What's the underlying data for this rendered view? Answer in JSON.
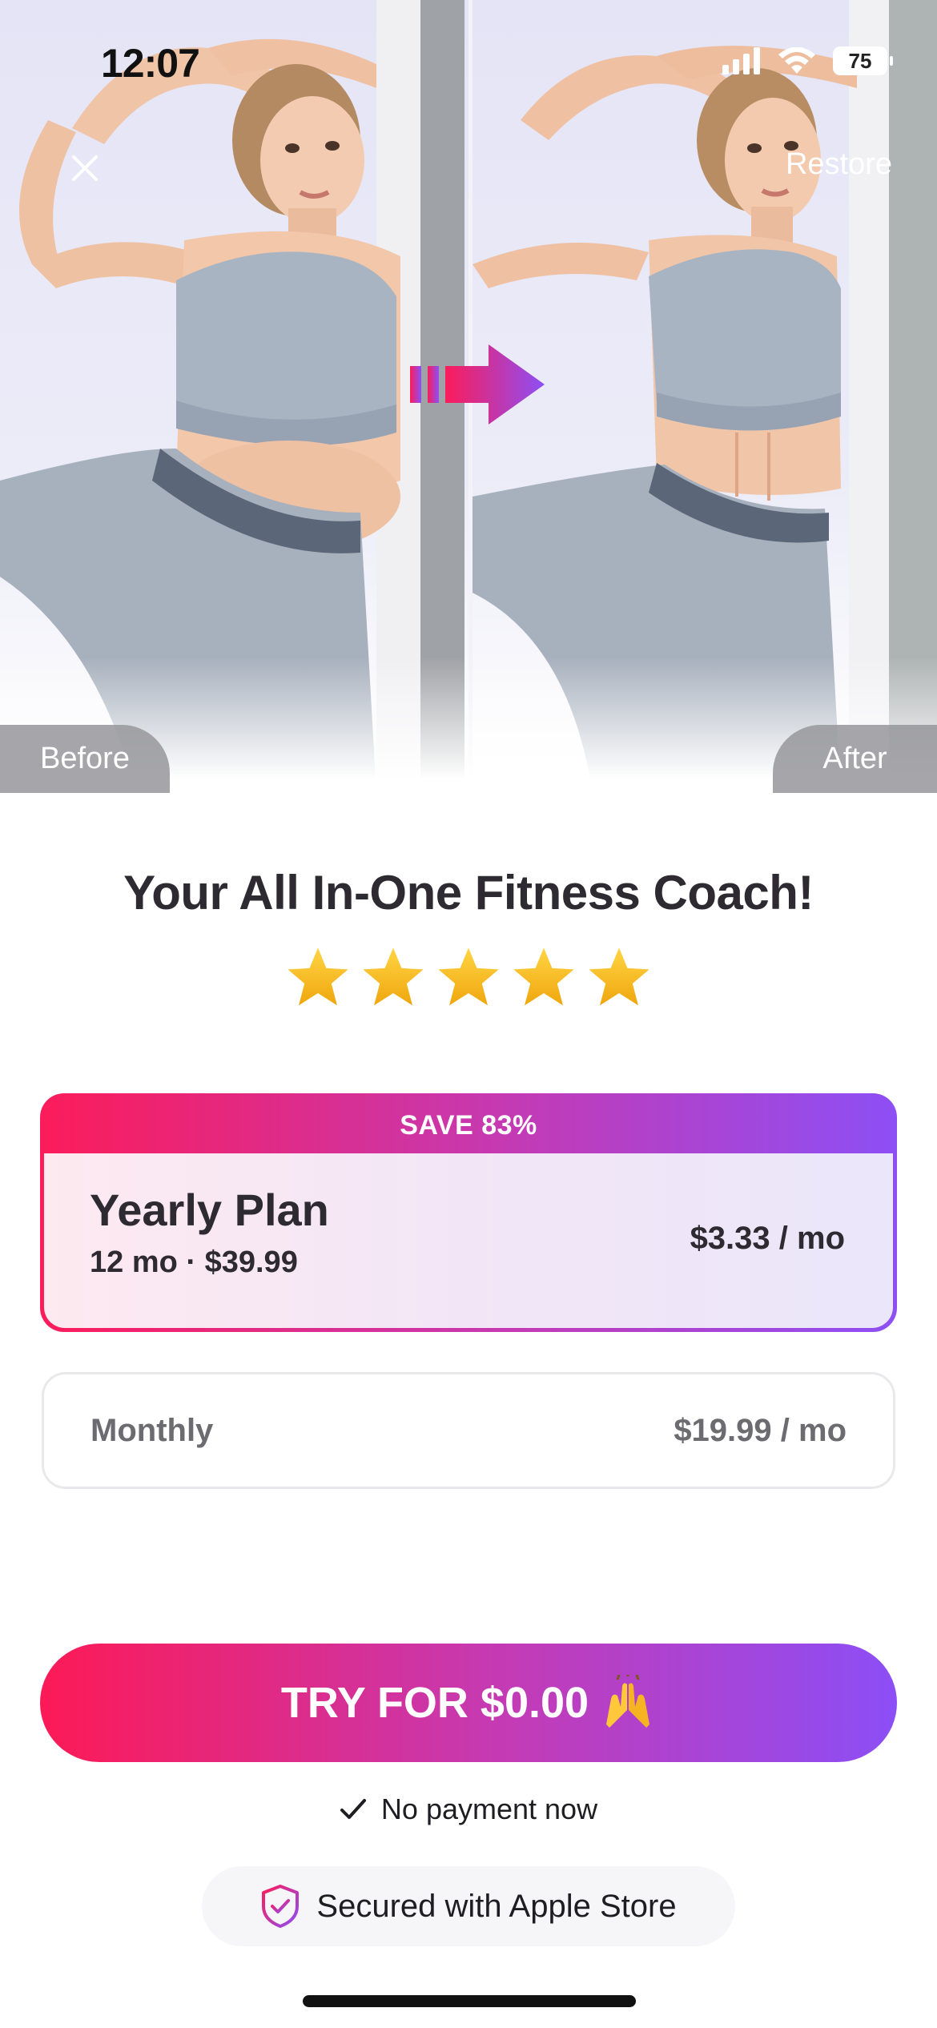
{
  "status_bar": {
    "time": "12:07",
    "battery": "75"
  },
  "hero": {
    "close_icon": "close-icon",
    "restore_label": "Restore",
    "before_label": "Before",
    "after_label": "After"
  },
  "headline": "Your All In-One Fitness Coach!",
  "rating": {
    "stars": 5,
    "max": 5,
    "star_color": "#f6b91b"
  },
  "plans": {
    "yearly": {
      "badge": "SAVE 83%",
      "title": "Yearly Plan",
      "subtitle": "12 mo · $39.99",
      "price": "$3.33 / mo",
      "selected": true
    },
    "monthly": {
      "title": "Monthly",
      "price": "$19.99 / mo",
      "selected": false
    }
  },
  "cta": {
    "label": "TRY FOR $0.00",
    "emoji": "raising-hands-icon"
  },
  "footer": {
    "no_payment": "No payment now",
    "secured": "Secured with Apple Store"
  },
  "colors": {
    "gradient_start": "#fb1c5a",
    "gradient_mid": "#c43ab4",
    "gradient_end": "#8d4ff5",
    "text_dark": "#2d2a31",
    "text_muted": "#6b6b70"
  }
}
